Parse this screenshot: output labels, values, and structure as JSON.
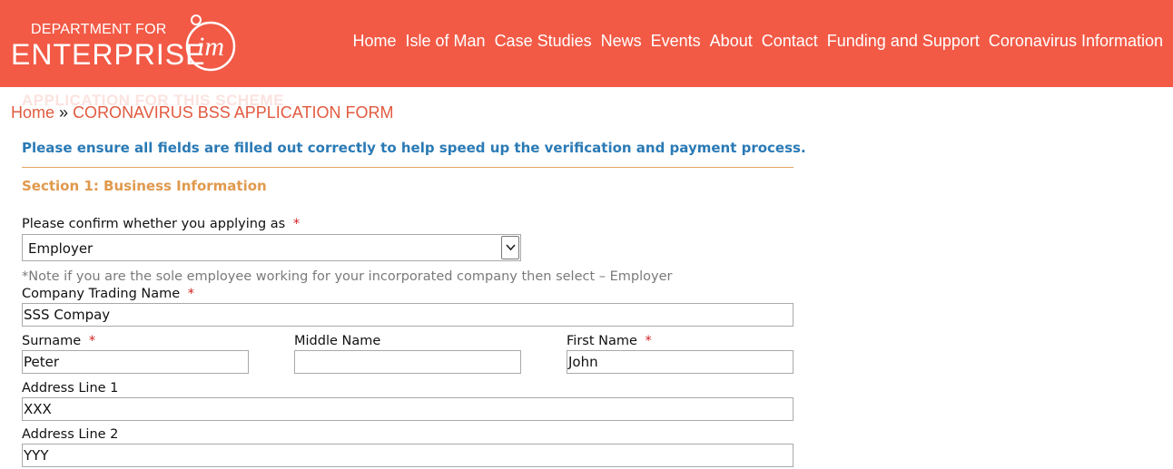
{
  "header": {
    "logo": {
      "line1": "DEPARTMENT FOR",
      "line2": "ENTERPRISE",
      "mark": "im"
    },
    "nav": [
      "Home",
      "Isle of Man",
      "Case Studies",
      "News",
      "Events",
      "About",
      "Contact",
      "Funding and Support",
      "Coronavirus Information"
    ],
    "color": "#f25a46"
  },
  "ghost_heading": "APPLICATION FOR THIS SCHEME",
  "breadcrumb": {
    "home": "Home",
    "separator": "»",
    "current": "CORONAVIRUS BSS APPLICATION FORM"
  },
  "form": {
    "intro": "Please ensure all fields are filled out correctly to help speed up the verification and payment process.",
    "section_title": "Section 1: Business Information",
    "applying_as": {
      "label": "Please confirm whether you applying as",
      "required": "*",
      "value": "Employer",
      "icon": "chevron-down-icon"
    },
    "note": "*Note if you are the sole employee working for your incorporated company then select – Employer",
    "company_trading_name": {
      "label": "Company Trading Name",
      "required": "*",
      "value": "SSS Compay"
    },
    "surname": {
      "label": "Surname",
      "required": "*",
      "value": "Peter"
    },
    "middle_name": {
      "label": "Middle Name",
      "value": ""
    },
    "first_name": {
      "label": "First Name",
      "required": "*",
      "value": "John"
    },
    "address_line_1": {
      "label": "Address Line 1",
      "value": "XXX"
    },
    "address_line_2": {
      "label": "Address Line 2",
      "value": "YYY"
    }
  }
}
